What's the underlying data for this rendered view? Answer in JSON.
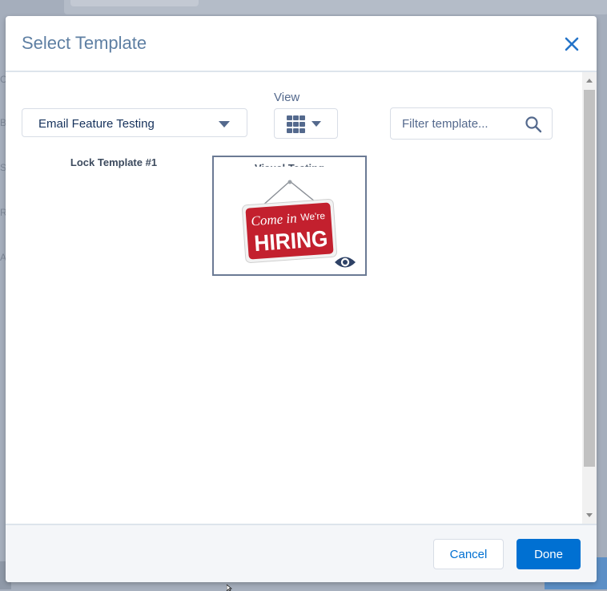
{
  "background": {
    "side_letters": [
      "C",
      "B",
      "S",
      "R",
      "A"
    ]
  },
  "modal": {
    "title": "Select Template",
    "close_icon": "close-icon",
    "toolbar": {
      "folder_value": "Email Feature Testing",
      "view_label": "View",
      "view_icon": "grid-icon",
      "filter_placeholder": "Filter template...",
      "filter_value": ""
    },
    "templates": [
      {
        "name": "Lock Template #1"
      },
      {
        "name": "Visual Testing",
        "image": "come-in-were-hiring-sign",
        "image_text": [
          "Come in",
          "We're",
          "HIRING"
        ],
        "preview_icon": "eye-icon"
      }
    ],
    "footer": {
      "cancel_label": "Cancel",
      "done_label": "Done"
    }
  },
  "colors": {
    "accent": "#0070d2",
    "title": "#5e7fa3",
    "text": "#16325c",
    "overlay": "#a7b0be"
  }
}
